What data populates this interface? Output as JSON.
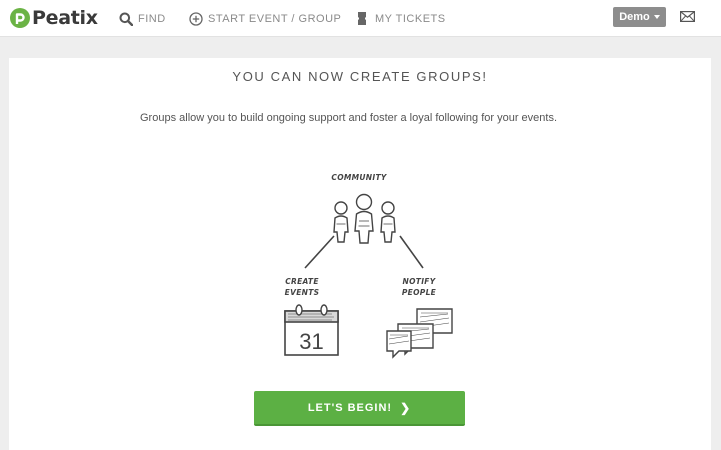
{
  "header": {
    "logo_text": "Peatix",
    "nav": {
      "find": "FIND",
      "start": "START EVENT / GROUP",
      "tickets": "MY TICKETS"
    },
    "user_menu": "Demo",
    "icons": {
      "logo": "peatix-logo-icon",
      "find": "search-icon",
      "start": "plus-circle-icon",
      "tickets": "ticket-icon",
      "mail": "mail-icon"
    }
  },
  "main": {
    "title": "YOU CAN NOW CREATE GROUPS!",
    "description": "Groups allow you to build ongoing support and foster a loyal following for your events.",
    "illustration": {
      "community": "COMMUNITY",
      "create_events": "CREATE EVENTS",
      "notify_people": "NOTIFY PEOPLE",
      "calendar_day": "31"
    },
    "cta_label": "LET'S BEGIN!",
    "cta_icon": "chevron-right-icon"
  },
  "colors": {
    "brand_green": "#5cb044",
    "logo_green": "#6bb345",
    "page_bg": "#eeeeee",
    "demo_btn": "#8d8d8d"
  }
}
